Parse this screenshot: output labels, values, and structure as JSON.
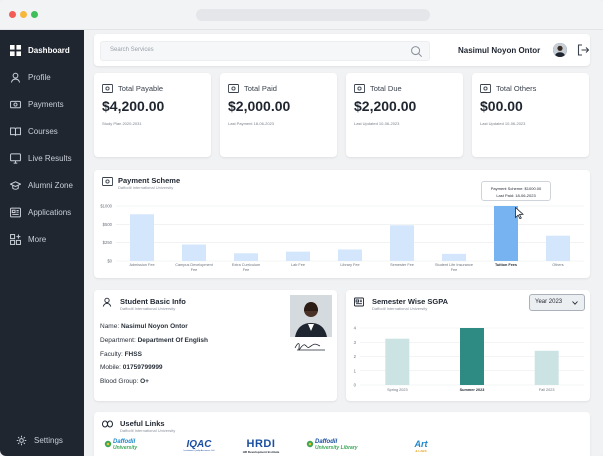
{
  "window": {
    "dots": [
      "#f25c54",
      "#f6b73c",
      "#3dbf5a"
    ]
  },
  "sidebar": {
    "items": [
      {
        "label": "Dashboard",
        "icon": "grid-icon"
      },
      {
        "label": "Profile",
        "icon": "user-icon"
      },
      {
        "label": "Payments",
        "icon": "money-icon"
      },
      {
        "label": "Courses",
        "icon": "book-icon"
      },
      {
        "label": "Live Results",
        "icon": "monitor-icon"
      },
      {
        "label": "Alumni Zone",
        "icon": "graduation-icon"
      },
      {
        "label": "Applications",
        "icon": "newspaper-icon"
      },
      {
        "label": "More",
        "icon": "apps-icon"
      }
    ],
    "settings_label": "Settings"
  },
  "topbar": {
    "search_placeholder": "Search Services",
    "user_name": "Nasimul Noyon Ontor"
  },
  "stats": [
    {
      "title": "Total Payable",
      "value": "$4,200.00",
      "sub": "Study Plan 2020-2031"
    },
    {
      "title": "Total Paid",
      "value": "$2,000.00",
      "sub": "Last Payment 18-06-2023"
    },
    {
      "title": "Total Due",
      "value": "$2,200.00",
      "sub": "Last Updated 10-06-2023"
    },
    {
      "title": "Total Others",
      "value": "$00.00",
      "sub": "Last Updated 10-06-2023"
    }
  ],
  "payment_scheme": {
    "title": "Payment Scheme",
    "subtitle": "Daffodil International University",
    "tooltip_line1": "Payment Scheme: $1000.00",
    "tooltip_line2": "Last Paid: 18-06-2023"
  },
  "chart_data": [
    {
      "type": "bar",
      "title": "Payment Scheme",
      "categories": [
        "Admission Fee",
        "Campus Development Fee",
        "Extra Curriculum Fee",
        "Lab Fee",
        "Library Fee",
        "Semester Fee",
        "Student Life Insurance",
        "Tuition Fees",
        "Others"
      ],
      "values": [
        850,
        300,
        140,
        170,
        210,
        650,
        130,
        1000,
        460
      ],
      "yticks": [
        "$1000",
        "$500",
        "$250",
        "$0"
      ],
      "ylim": [
        0,
        1000
      ],
      "highlight": "Tuition Fees",
      "colors": {
        "bar": "#d3e6fb",
        "highlight": "#77b3f0"
      }
    },
    {
      "type": "bar",
      "title": "Semester Wise SGPA",
      "categories": [
        "Spring 2023",
        "Summer 2023",
        "Fall 2023"
      ],
      "values": [
        3.25,
        4.0,
        2.4
      ],
      "yticks": [
        "4",
        "3",
        "2",
        "1",
        "0"
      ],
      "ylim": [
        0,
        4
      ],
      "highlight": "Summer 2023",
      "colors": {
        "bar": "#cbe3e3",
        "highlight": "#2e8b83"
      }
    }
  ],
  "student_info": {
    "title": "Student Basic Info",
    "subtitle": "Daffodil International University",
    "name_label": "Name:",
    "name": "Nasimul Noyon Ontor",
    "department_label": "Department:",
    "department": "Department Of English",
    "faculty_label": "Faculty:",
    "faculty": "FHSS",
    "mobile_label": "Mobile:",
    "mobile": "01759799999",
    "blood_label": "Blood Group:",
    "blood": "O+"
  },
  "sgpa": {
    "title": "Semester Wise SGPA",
    "subtitle": "Daffodil International University",
    "year_select": "Year 2023"
  },
  "links": {
    "title": "Useful Links",
    "subtitle": "Daffodil International University",
    "items": [
      {
        "line1": "Daffodil",
        "line2": "University"
      },
      {
        "line1": "IQAC",
        "line2": "Institutional Quality Assurance Cell"
      },
      {
        "line1": "HRDI",
        "line2": "HR Development Institute"
      },
      {
        "line1": "Daffodil",
        "line2": "University Library"
      },
      {
        "line1": "Art",
        "line2": "& LABS"
      }
    ]
  }
}
